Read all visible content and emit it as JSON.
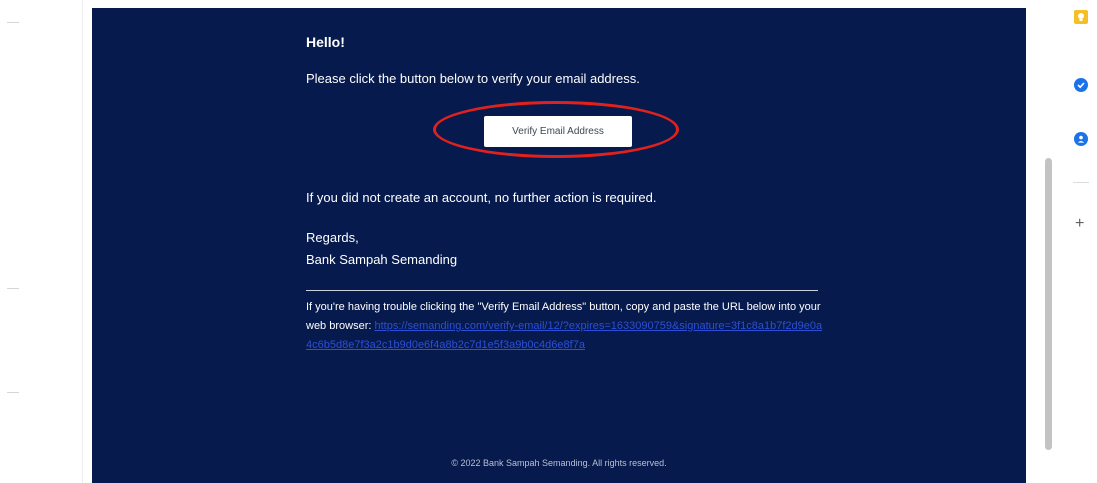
{
  "email": {
    "greeting": "Hello!",
    "intro": "Please click the button below to verify your email address.",
    "verify_button_label": "Verify Email Address",
    "no_action": "If you did not create an account, no further action is required.",
    "regards": "Regards,",
    "sender": "Bank Sampah Semanding",
    "subcopy_text": "If you're having trouble clicking the \"Verify Email Address\" button, copy and paste the URL below into your web browser: ",
    "verify_url": "https://semanding.com/verify-email/12/?expires=1633090759&signature=3f1c8a1b7f2d9e0a4c6b5d8e7f3a2c1b9d0e6f4a8b2c7d1e5f3a9b0c4d6e8f7a",
    "footer": "© 2022 Bank Sampah Semanding. All rights reserved."
  },
  "side_panel": {
    "icons": [
      "keep-icon",
      "tasks-icon",
      "contacts-icon",
      "plus-icon"
    ],
    "add_glyph": "+"
  },
  "colors": {
    "email_background": "#061a4d",
    "link": "#2d4fd6",
    "highlight": "#e0211d"
  }
}
